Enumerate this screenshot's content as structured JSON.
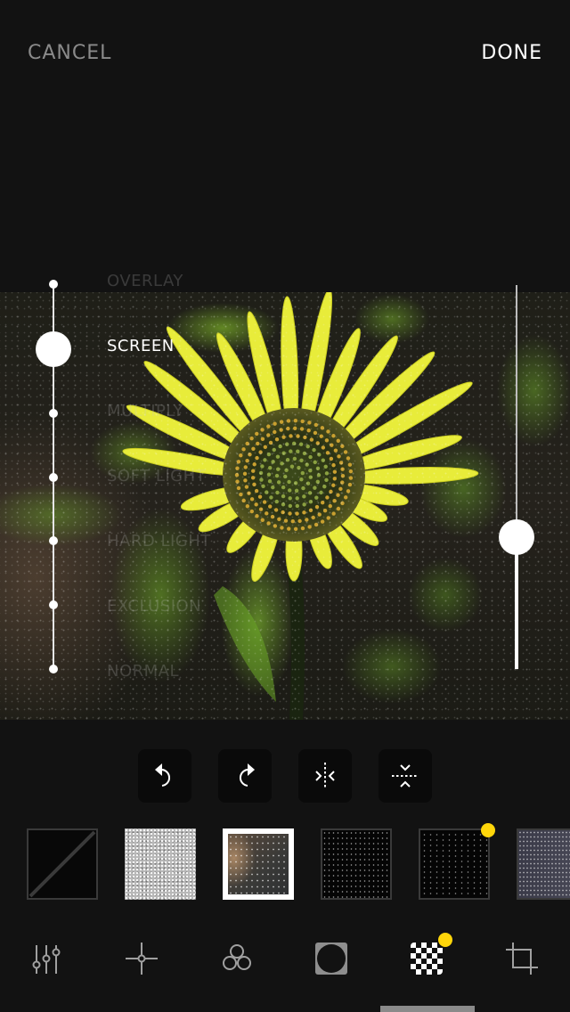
{
  "header": {
    "cancel_label": "CANCEL",
    "done_label": "DONE"
  },
  "blend_modes": {
    "items": [
      "OVERLAY",
      "SCREEN",
      "MULTIPLY",
      "SOFT LIGHT",
      "HARD LIGHT",
      "EXCLUSION",
      "NORMAL"
    ],
    "selected": "SCREEN",
    "selected_index": 1
  },
  "opacity_slider": {
    "value": 0.34
  },
  "photo": {
    "subject": "yellow coneflower with green bokeh background, grain texture overlay"
  },
  "tools": [
    {
      "name": "rotate-left",
      "icon": "rotate-left-icon"
    },
    {
      "name": "rotate-right",
      "icon": "rotate-right-icon"
    },
    {
      "name": "flip-horizontal",
      "icon": "flip-horizontal-icon"
    },
    {
      "name": "flip-vertical",
      "icon": "flip-vertical-icon"
    }
  ],
  "textures": [
    {
      "name": "none",
      "style": "none",
      "selected": false,
      "badge": false
    },
    {
      "name": "light-noise",
      "style": "light-noise",
      "selected": false,
      "badge": false
    },
    {
      "name": "warm-dust",
      "style": "warm-dust",
      "selected": true,
      "badge": false
    },
    {
      "name": "fine-dust",
      "style": "fine-dust",
      "selected": false,
      "badge": false
    },
    {
      "name": "scratch-dust",
      "style": "scratch-dust",
      "selected": false,
      "badge": true
    },
    {
      "name": "grey-grain",
      "style": "grey-grain",
      "selected": false,
      "badge": false
    }
  ],
  "bottom_tabs": [
    {
      "name": "adjust",
      "icon": "sliders-icon",
      "active": false,
      "badge": false
    },
    {
      "name": "focus",
      "icon": "crosshair-icon",
      "active": false,
      "badge": false
    },
    {
      "name": "color-mix",
      "icon": "circles-icon",
      "active": false,
      "badge": false
    },
    {
      "name": "vignette",
      "icon": "vignette-icon",
      "active": false,
      "badge": false
    },
    {
      "name": "texture",
      "icon": "checkerboard-icon",
      "active": true,
      "badge": true
    },
    {
      "name": "crop",
      "icon": "crop-icon",
      "active": false,
      "badge": false
    }
  ],
  "colors": {
    "background": "#121212",
    "accent_badge": "#ffd60a",
    "inactive_text": "#8a8a8a",
    "active_text": "#ffffff"
  }
}
